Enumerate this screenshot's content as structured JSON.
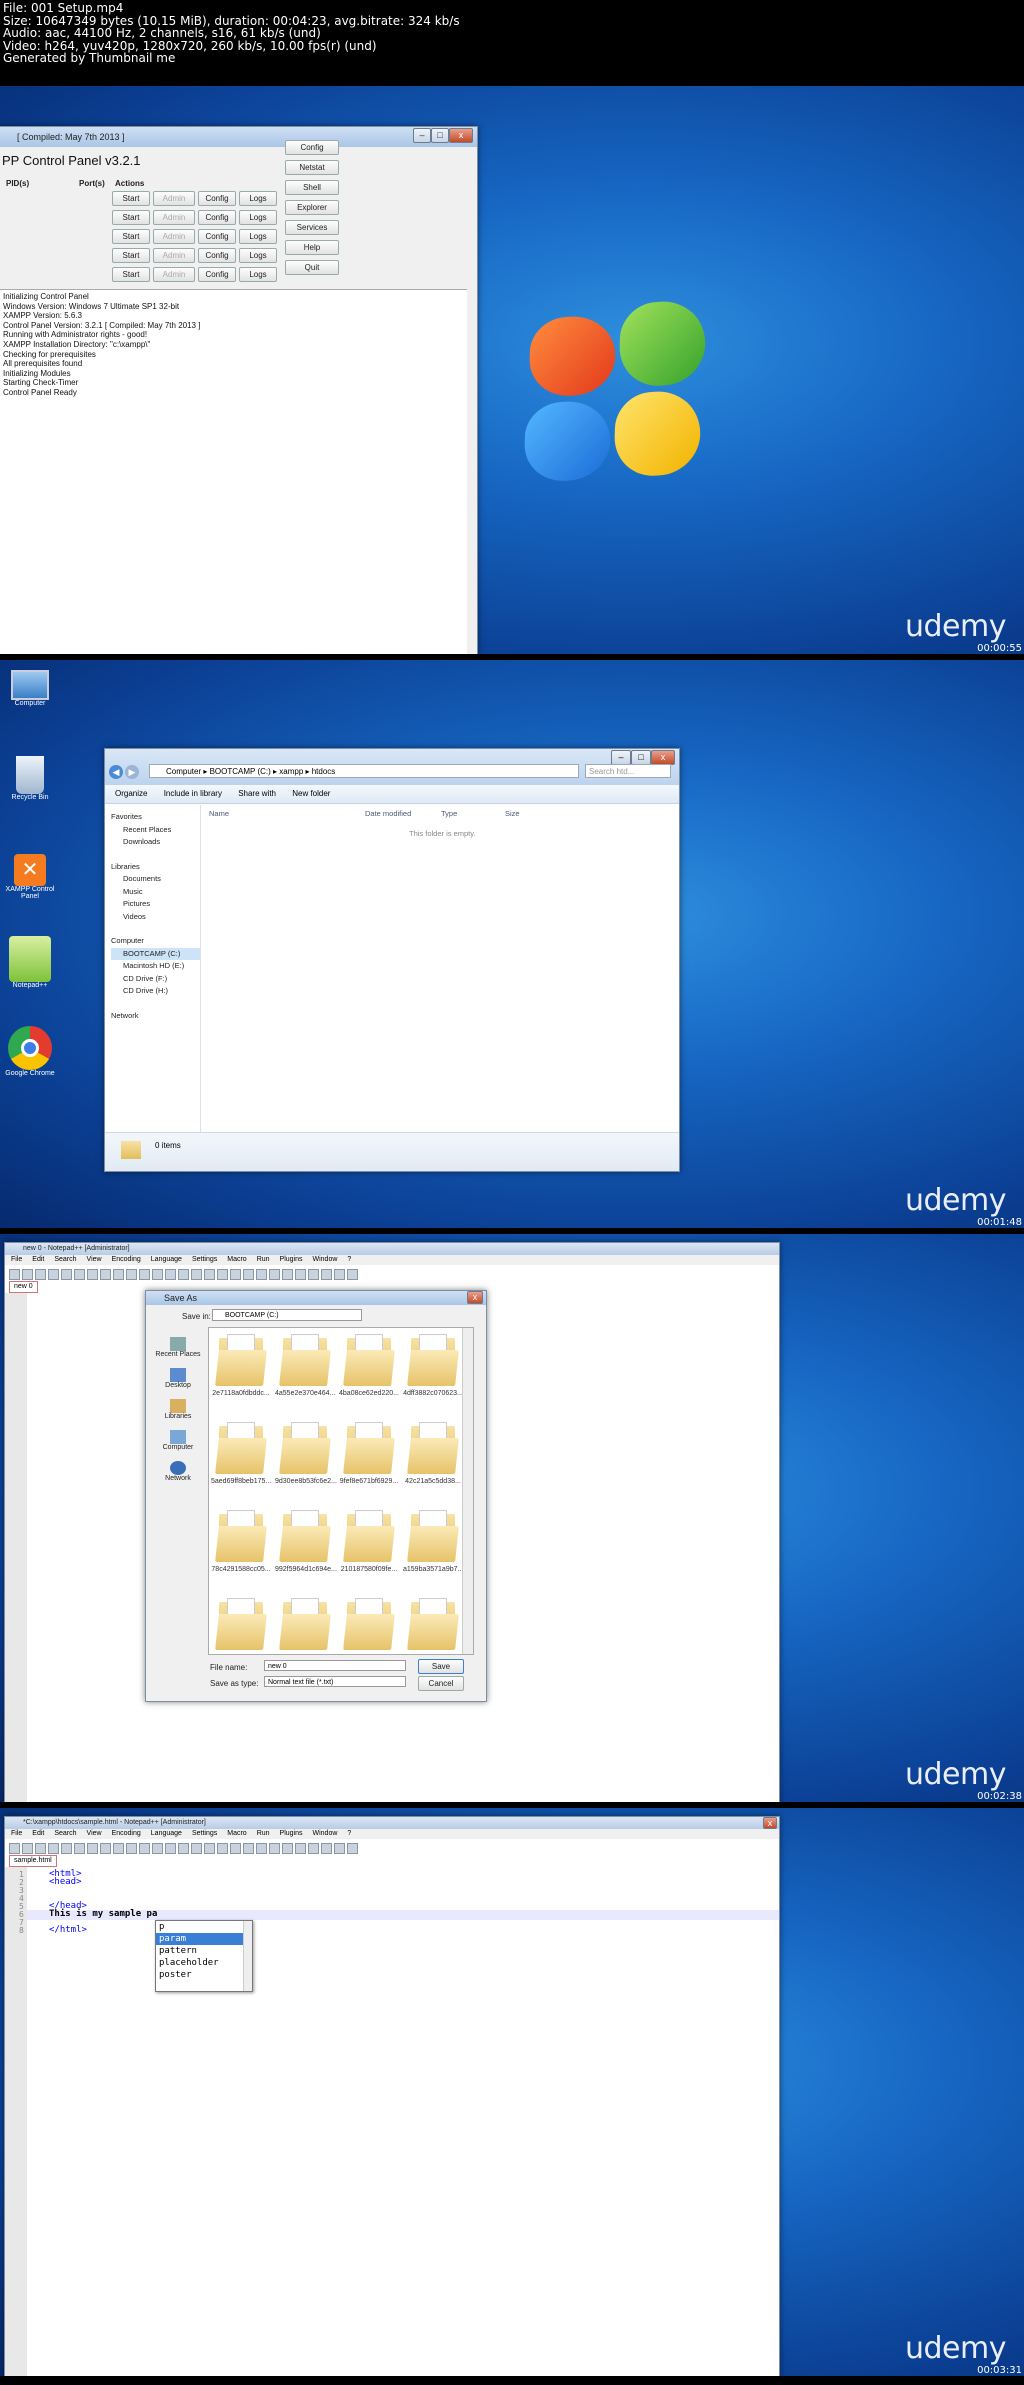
{
  "header": {
    "lines": [
      "File: 001 Setup.mp4",
      "Size: 10647349 bytes (10.15 MiB), duration: 00:04:23, avg.bitrate: 324 kb/s",
      "Audio: aac, 44100 Hz, 2 channels, s16, 61 kb/s (und)",
      "Video: h264, yuv420p, 1280x720, 260 kb/s, 10.00 fps(r) (und)",
      "Generated by Thumbnail me"
    ]
  },
  "branding": "udemy",
  "frames": [
    {
      "timestamp": "00:00:55",
      "xampp": {
        "title": "[ Compiled: May 7th 2013 ]",
        "heading": "PP Control Panel v3.2.1",
        "columns": [
          "PID(s)",
          "Port(s)",
          "Actions"
        ],
        "row_buttons": [
          "Start",
          "Admin",
          "Config",
          "Logs"
        ],
        "side_buttons": [
          "Config",
          "Netstat",
          "Shell",
          "Explorer",
          "Services",
          "Help",
          "Quit"
        ],
        "log": [
          "Initializing Control Panel",
          "Windows Version: Windows 7 Ultimate SP1 32-bit",
          "XAMPP Version: 5.6.3",
          "Control Panel Version: 3.2.1  [ Compiled: May 7th 2013 ]",
          "Running with Administrator rights - good!",
          "XAMPP Installation Directory: \"c:\\xampp\\\"",
          "Checking for prerequisites",
          "All prerequisites found",
          "Initializing Modules",
          "Starting Check-Timer",
          "Control Panel Ready"
        ]
      }
    },
    {
      "timestamp": "00:01:48",
      "desktop_icons": [
        "Computer",
        "Recycle Bin",
        "XAMPP Control Panel",
        "Notepad++",
        "Google Chrome"
      ],
      "explorer": {
        "breadcrumb": [
          "Computer",
          "BOOTCAMP (C:)",
          "xampp",
          "htdocs"
        ],
        "search_placeholder": "Search htd...",
        "toolbar": [
          "Organize",
          "Include in library",
          "Share with",
          "New folder"
        ],
        "nav": {
          "favorites": {
            "label": "Favorites",
            "items": [
              "Recent Places",
              "Downloads"
            ]
          },
          "libraries": {
            "label": "Libraries",
            "items": [
              "Documents",
              "Music",
              "Pictures",
              "Videos"
            ]
          },
          "computer": {
            "label": "Computer",
            "items": [
              "BOOTCAMP (C:)",
              "Macintosh HD (E:)",
              "CD Drive (F:)",
              "CD Drive (H:)"
            ]
          },
          "network": "Network"
        },
        "columns": [
          "Name",
          "Date modified",
          "Type",
          "Size"
        ],
        "empty": "This folder is empty.",
        "status": "0 items"
      }
    },
    {
      "timestamp": "00:02:38",
      "notepad": {
        "title": "new 0 - Notepad++ [Administrator]",
        "menu": [
          "File",
          "Edit",
          "Search",
          "View",
          "Encoding",
          "Language",
          "Settings",
          "Macro",
          "Run",
          "Plugins",
          "Window",
          "?"
        ],
        "tab": "new 0"
      },
      "save_as": {
        "title": "Save As",
        "save_in_label": "Save in:",
        "save_in_value": "BOOTCAMP (C:)",
        "places": [
          "Recent Places",
          "Desktop",
          "Libraries",
          "Computer",
          "Network"
        ],
        "folders": [
          "2e7118a0fdbddc...",
          "4a55e2e370e464...",
          "4ba08ce62ed220...",
          "4dff3882c070623...",
          "5aed69ff8beb175...",
          "9d30ee8b53fc6e2...",
          "9fef8e671bf6929...",
          "42c21a5c5dd38...",
          "78c4291588cc05...",
          "992f5964d1c694e...",
          "210187580f09fe...",
          "a159ba3571a9b7...",
          "",
          "",
          "",
          ""
        ],
        "file_name_label": "File name:",
        "file_name_value": "new 0",
        "save_type_label": "Save as type:",
        "save_type_value": "Normal text file (*.txt)",
        "save_button": "Save",
        "cancel_button": "Cancel"
      }
    },
    {
      "timestamp": "00:03:31",
      "notepad": {
        "title": "*C:\\xampp\\htdocs\\sample.html - Notepad++ [Administrator]",
        "menu": [
          "File",
          "Edit",
          "Search",
          "View",
          "Encoding",
          "Language",
          "Settings",
          "Macro",
          "Run",
          "Plugins",
          "Window",
          "?"
        ],
        "tab": "sample.html",
        "lines": [
          "<html>",
          "<head>",
          "",
          "",
          "</head>",
          "This is my sample pa",
          "",
          "</html>"
        ],
        "line_numbers": [
          "1",
          "2",
          "3",
          "4",
          "5",
          "6",
          "7",
          "8"
        ],
        "autocomplete": [
          "p",
          "param",
          "pattern",
          "placeholder",
          "poster"
        ]
      }
    }
  ]
}
